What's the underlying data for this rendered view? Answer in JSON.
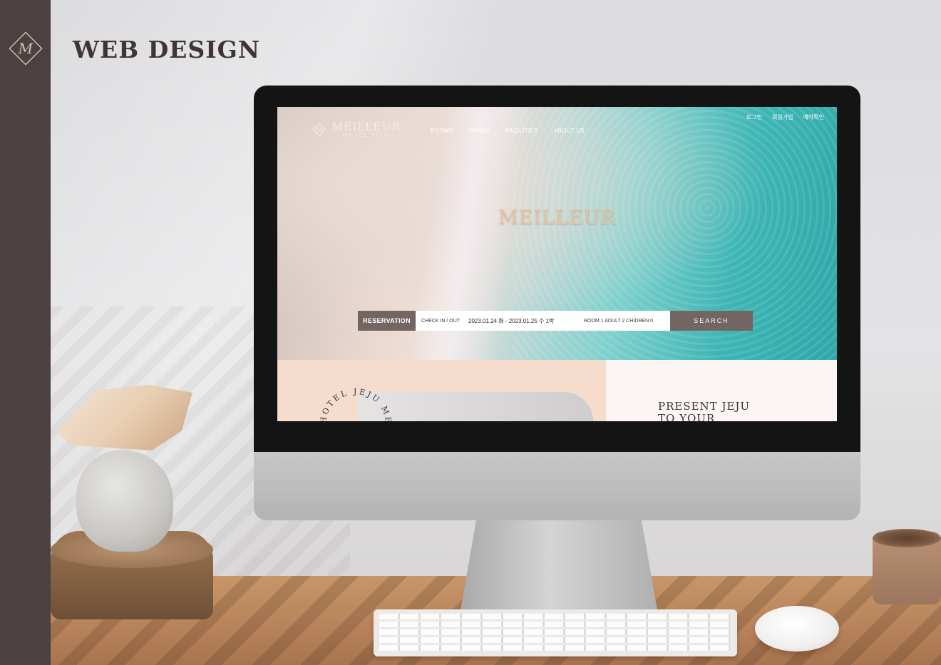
{
  "brand": {
    "title": "WEB DESIGN",
    "badge_letter": "M"
  },
  "site": {
    "logo_name": "MEILLEUR",
    "logo_sub": "HOTEL JEJU",
    "nav": [
      {
        "label": "ROOMS"
      },
      {
        "label": "DINING"
      },
      {
        "label": "FACILITIES"
      },
      {
        "label": "ABOUT US"
      }
    ],
    "util_links": [
      {
        "label": "로그인"
      },
      {
        "label": "회원가입"
      },
      {
        "label": "예약확인"
      }
    ],
    "hero_title": "MEILLEUR",
    "reservation": {
      "label": "RESERVATION",
      "check_label": "CHECK IN / OUT",
      "dates": "2023.01.24 화 -  2023.01.25 수   1박",
      "guests": "ROOM 1  ADULT 2  CHIDREN 0",
      "search_label": "SEARCH"
    },
    "lower": {
      "circular_text": "HOTEL JEJU MEILLEUR",
      "present_line1": "PRESENT JEJU",
      "present_line2": "TO YOUR"
    }
  },
  "colors": {
    "sidebar": "#4a4140",
    "accent_brown": "#736662",
    "hero_gold": "#e4c4a2",
    "sea": "#3fb6b5"
  }
}
